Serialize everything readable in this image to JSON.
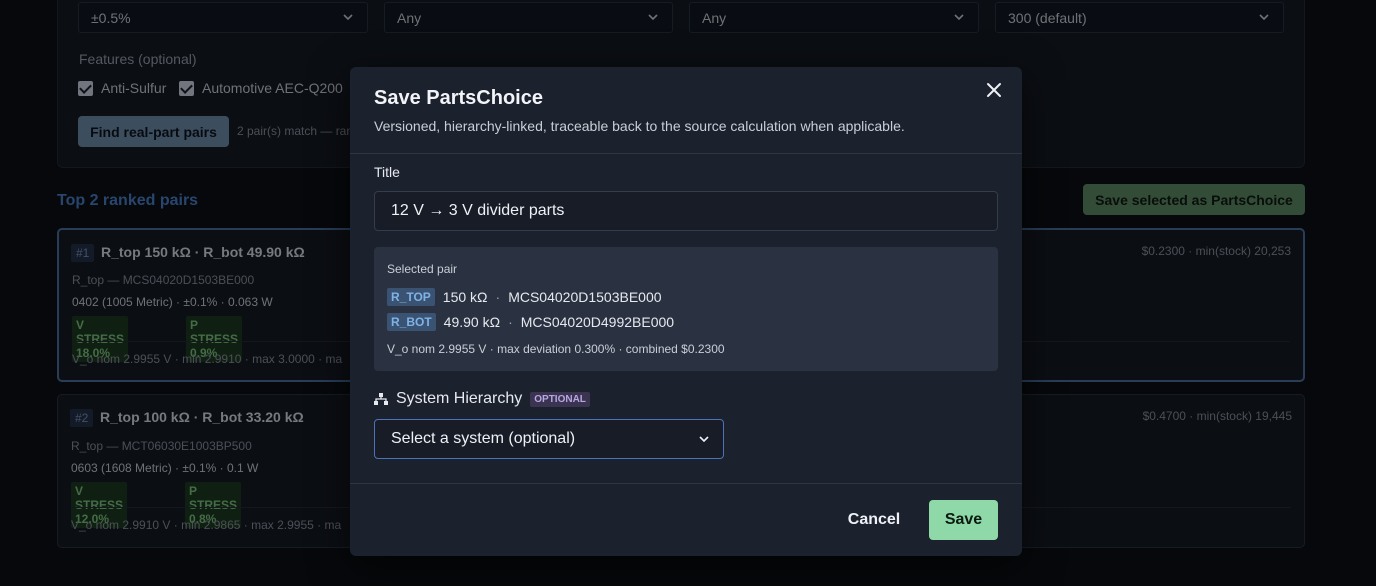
{
  "background": {
    "filters": {
      "selects": [
        "±0.5%",
        "Any",
        "Any",
        "300 (default)"
      ],
      "features_label": "Features (optional)",
      "checkboxes": [
        "Anti-Sulfur",
        "Automotive AEC-Q200"
      ],
      "find_button": "Find real-part pairs",
      "match_text": "2 pair(s) match — ran"
    },
    "results": {
      "title": "Top 2 ranked pairs",
      "save_selected_button": "Save selected as PartsChoice",
      "pairs": [
        {
          "rank": "#1",
          "title": "R_top 150 kΩ · R_bot 49.90 kΩ",
          "part": "R_top — MCS04020D1503BE000",
          "package": "0402 (1005 Metric) · ±0.1% · 0.063 W",
          "v_stress": "V STRESS 18.0%",
          "p_stress": "P STRESS 0.9%",
          "price_stock": "$0.2300 · min(stock) 20,253",
          "vo_line": "V_o nom 2.9955 V  · min 2.9910  · max 3.0000  · ma"
        },
        {
          "rank": "#2",
          "title": "R_top 100 kΩ · R_bot 33.20 kΩ",
          "part": "R_top — MCT06030E1003BP500",
          "package": "0603 (1608 Metric) · ±0.1% · 0.1 W",
          "v_stress": "V STRESS 12.0%",
          "p_stress": "P STRESS 0.8%",
          "price_stock": "$0.4700 · min(stock) 19,445",
          "vo_line": "V_o nom 2.9910 V  · min 2.9865  · max 2.9955  · ma"
        }
      ]
    }
  },
  "modal": {
    "title": "Save PartsChoice",
    "description": "Versioned, hierarchy-linked, traceable back to the source calculation when applicable.",
    "title_label": "Title",
    "title_value": "12 V → 3 V divider parts",
    "selected_pair": {
      "label": "Selected pair",
      "parts": [
        {
          "tag": "R_TOP",
          "value": "150 kΩ",
          "sep": "·",
          "mpn": "MCS04020D1503BE000"
        },
        {
          "tag": "R_BOT",
          "value": "49.90 kΩ",
          "sep": "·",
          "mpn": "MCS04020D4992BE000"
        }
      ],
      "summary": "V_o nom 2.9955 V · max deviation 0.300% · combined $0.2300"
    },
    "hierarchy": {
      "label": "System Hierarchy",
      "badge": "OPTIONAL",
      "select_value": "Select a system (optional)"
    },
    "cancel_label": "Cancel",
    "save_label": "Save"
  }
}
